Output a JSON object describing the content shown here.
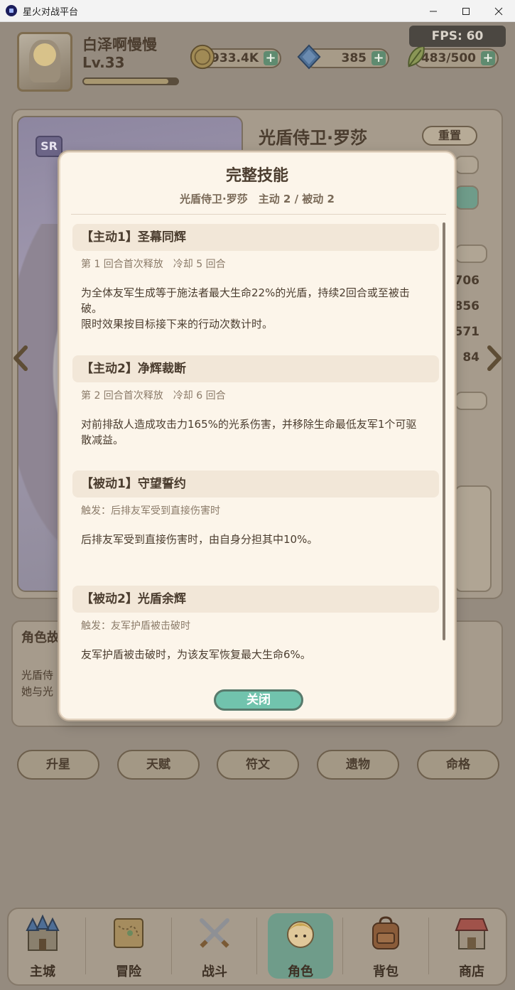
{
  "window": {
    "title": "星火对战平台",
    "buttons": [
      "minimize",
      "maximize",
      "close"
    ]
  },
  "header": {
    "player_name": "白泽啊慢慢",
    "level": "Lv.33",
    "exp_fraction": 0.9,
    "resources": {
      "gold": "933.4K",
      "gems": "385",
      "stamina": "483/500"
    },
    "fps": "FPS: 60"
  },
  "hero": {
    "rarity": "SR",
    "name": "光盾侍卫·罗莎",
    "reset_label": "重置",
    "stats": [
      "706",
      "856",
      "571",
      "84"
    ]
  },
  "story": {
    "title": "角色故",
    "lines": [
      "光盾侍",
      "她与光"
    ]
  },
  "actions": [
    "升星",
    "天赋",
    "符文",
    "遗物",
    "命格"
  ],
  "nav": {
    "items": [
      {
        "label": "主城",
        "icon": "castle-icon"
      },
      {
        "label": "冒险",
        "icon": "map-icon"
      },
      {
        "label": "战斗",
        "icon": "crossed-swords-icon"
      },
      {
        "label": "角色",
        "icon": "character-icon"
      },
      {
        "label": "背包",
        "icon": "backpack-icon"
      },
      {
        "label": "商店",
        "icon": "shop-icon"
      }
    ],
    "active_index": 3
  },
  "modal": {
    "title": "完整技能",
    "subtitle": "光盾侍卫·罗莎　主动 2 / 被动 2",
    "skills": [
      {
        "name": "【主动1】圣幕同辉",
        "meta": "第 1 回合首次释放　冷却 5 回合",
        "desc": [
          "为全体友军生成等于施法者最大生命22%的光盾，持续2回合或至被击破。",
          "限时效果按目标接下来的行动次数计时。"
        ]
      },
      {
        "name": "【主动2】净辉裁断",
        "meta": "第 2 回合首次释放　冷却 6 回合",
        "desc": [
          "对前排敌人造成攻击力165%的光系伤害，并移除生命最低友军1个可驱散减益。"
        ]
      },
      {
        "name": "【被动1】守望誓约",
        "meta": "触发：后排友军受到直接伤害时",
        "desc": [
          "后排友军受到直接伤害时，由自身分担其中10%。"
        ]
      },
      {
        "name": "【被动2】光盾余辉",
        "meta": "触发：友军护盾被击破时",
        "desc": [
          "友军护盾被击破时，为该友军恢复最大生命6%。"
        ]
      }
    ],
    "close_label": "关闭"
  }
}
